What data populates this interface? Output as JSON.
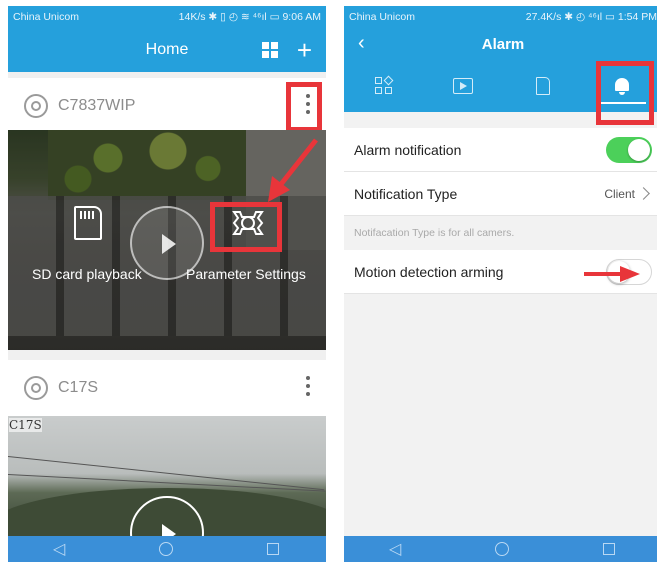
{
  "left": {
    "statusbar": {
      "carrier": "China Unicom",
      "right": "14K/s ✱ ▯ ◴ ≋ ⁴⁶ıl ▭ 9:06 AM"
    },
    "appbar": {
      "title": "Home"
    },
    "cameras": [
      {
        "name": "C7837WIP"
      },
      {
        "name": "C17S",
        "osd": "C17S"
      }
    ],
    "overlay": {
      "sd_label": "SD card playback",
      "param_label": "Parameter Settings"
    },
    "colors": {
      "accent": "#25a0dc",
      "highlight": "#e8353a"
    }
  },
  "right": {
    "statusbar": {
      "carrier": "China Unicom",
      "right": "27.4K/s ✱ ◴ ⁴⁶ıl ▭ 1:54 PM"
    },
    "appbar": {
      "title": "Alarm"
    },
    "tabs": [
      {
        "icon": "device-grid-icon"
      },
      {
        "icon": "playback-icon"
      },
      {
        "icon": "sd-card-icon"
      },
      {
        "icon": "bell-icon",
        "active": true
      }
    ],
    "settings": {
      "alarm_notification": {
        "label": "Alarm notification",
        "enabled": true
      },
      "notification_type": {
        "label": "Notification Type",
        "value": "Client"
      },
      "hint": "Notifacation Type is for all camers.",
      "motion_detection": {
        "label": "Motion detection arming",
        "enabled": false
      }
    },
    "colors": {
      "toggle_on": "#4cd05a"
    }
  }
}
